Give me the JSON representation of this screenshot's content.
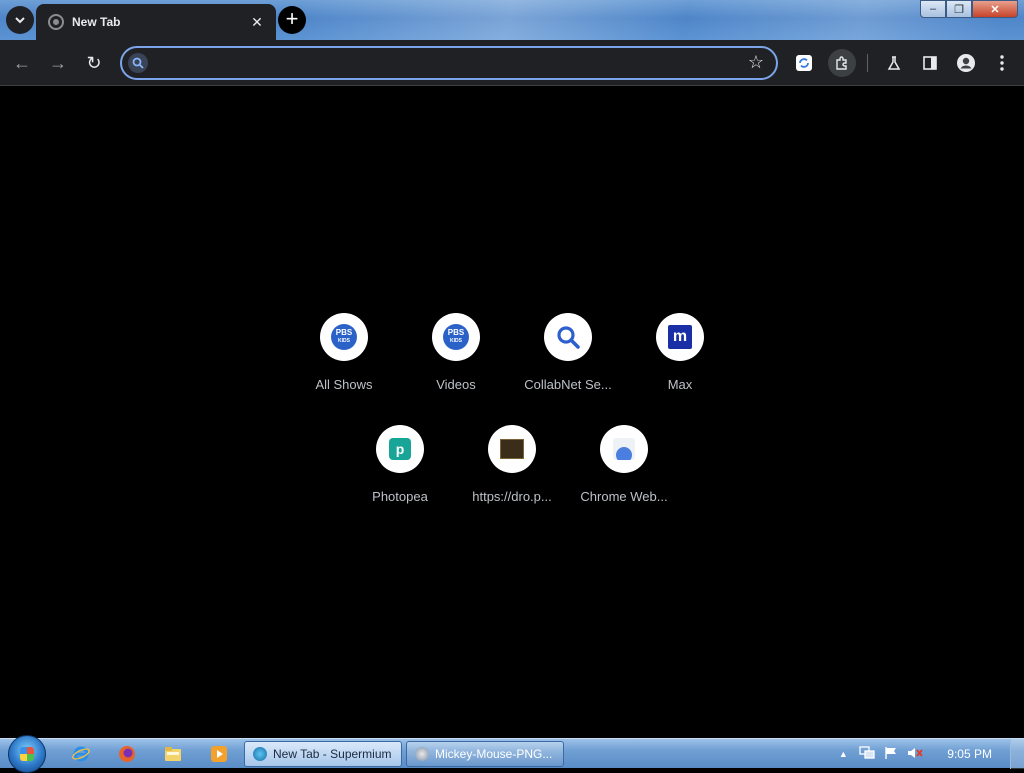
{
  "tab": {
    "title": "New Tab",
    "close": "✕"
  },
  "new_tab": "+",
  "window_controls": {
    "minimize": "–",
    "maximize": "❐",
    "close": "✕"
  },
  "toolbar": {
    "back": "←",
    "forward": "→",
    "reload": "↻",
    "star": "☆"
  },
  "omnibox": {
    "value": "",
    "placeholder": ""
  },
  "shortcuts_row1": [
    {
      "label": "All Shows",
      "icon": "pbs-kids-icon"
    },
    {
      "label": "Videos",
      "icon": "pbs-kids-icon"
    },
    {
      "label": "CollabNet Se...",
      "icon": "magnifier-icon"
    },
    {
      "label": "Max",
      "icon": "max-m-icon"
    }
  ],
  "shortcuts_row2": [
    {
      "label": "Photopea",
      "icon": "photopea-icon"
    },
    {
      "label": "https://dro.p...",
      "icon": "dro-thumbnail-icon"
    },
    {
      "label": "Chrome Web...",
      "icon": "chrome-web-store-icon"
    }
  ],
  "pbs": {
    "top": "PBS",
    "bottom": "KIDS"
  },
  "max_letter": "m",
  "photopea_letter": "p",
  "taskbar": {
    "items": [
      {
        "label": "New Tab - Supermium",
        "active": true
      },
      {
        "label": "Mickey-Mouse-PNG...",
        "active": false
      }
    ],
    "clock": "9:05 PM",
    "tray_arrow": "▲"
  }
}
